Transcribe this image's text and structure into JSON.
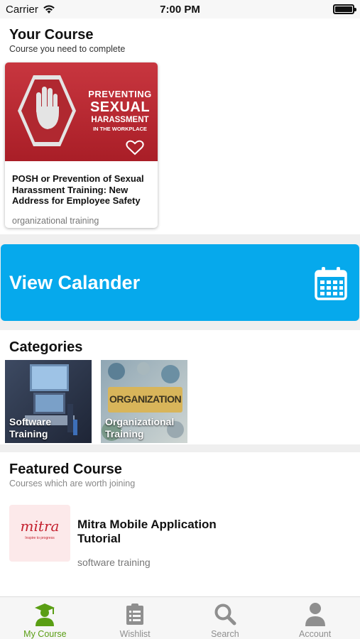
{
  "status_bar": {
    "carrier": "Carrier",
    "time": "7:00 PM"
  },
  "your_course": {
    "title": "Your Course",
    "subtitle": "Course you need to complete",
    "card": {
      "image_lines": [
        "PREVENTING",
        "SEXUAL",
        "HARASSMENT",
        "IN THE WORKPLACE"
      ],
      "title": "POSH or Prevention of Sexual Harassment Training: New Address for Employee Safety",
      "category": "organizational training",
      "icon": "heart-icon"
    }
  },
  "calendar": {
    "label": "View Calander",
    "icon": "calendar-icon",
    "color": "#06a9ec"
  },
  "categories": {
    "title": "Categories",
    "items": [
      {
        "label": "Software Training"
      },
      {
        "label": "Organizational Training",
        "image_text": "ORGANIZATION"
      }
    ]
  },
  "featured": {
    "title": "Featured Course",
    "subtitle": "Courses which are worth joining",
    "item": {
      "logo_text": "mitra",
      "logo_tagline": "Inspire to progress",
      "title": "Mitra Mobile Application Tutorial",
      "category": "software training"
    }
  },
  "tab_bar": {
    "active_color": "#5a9e14",
    "tabs": [
      {
        "label": "My Course",
        "icon": "graduate-icon",
        "active": true
      },
      {
        "label": "Wishlist",
        "icon": "clipboard-icon",
        "active": false
      },
      {
        "label": "Search",
        "icon": "search-icon",
        "active": false
      },
      {
        "label": "Account",
        "icon": "user-icon",
        "active": false
      }
    ]
  }
}
